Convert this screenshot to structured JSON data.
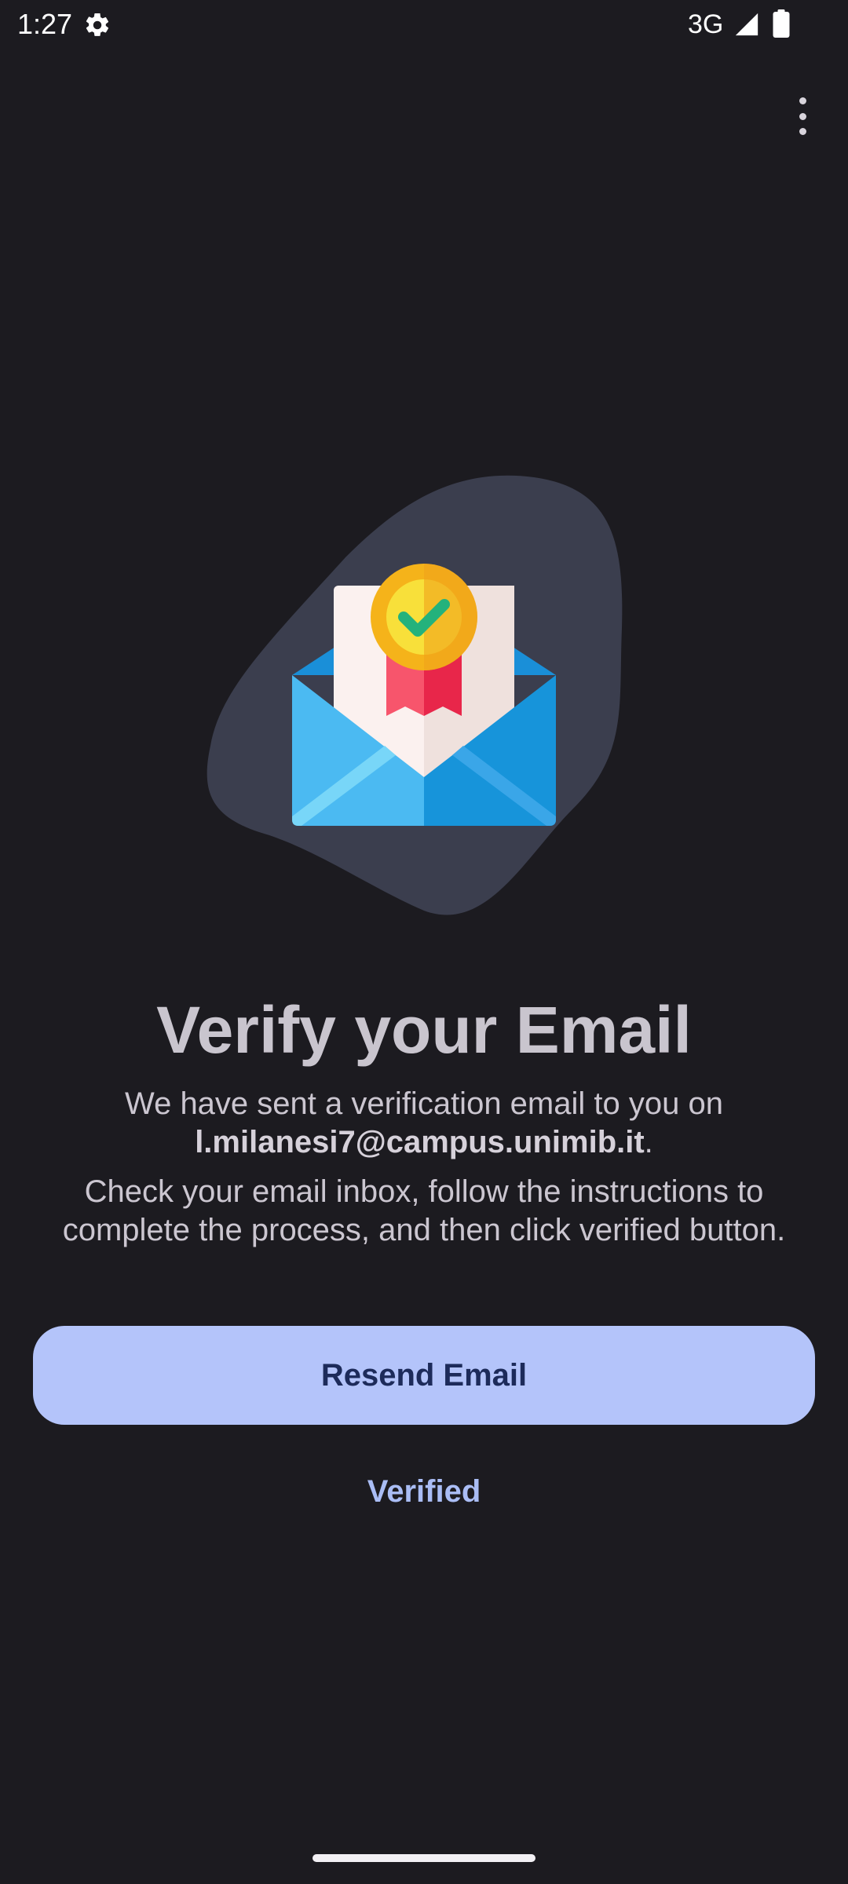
{
  "status_bar": {
    "time": "1:27",
    "network": "3G",
    "icons": [
      "gear-icon",
      "signal-icon",
      "battery-icon"
    ]
  },
  "toolbar": {
    "overflow_icon": "more-vert-icon"
  },
  "illustration": {
    "icon": "verified-email-envelope-icon"
  },
  "content": {
    "title": "Verify your Email",
    "message_prefix": "We have sent a verification email to you on",
    "email": "l.milanesi7@campus.unimib.it",
    "message_suffix": ".",
    "instructions": "Check your email inbox, follow the instructions to complete the process, and then click verified button."
  },
  "actions": {
    "resend_label": "Resend Email",
    "verified_label": "Verified"
  },
  "colors": {
    "background": "#1c1b20",
    "primary_button": "#b4c4fa",
    "primary_button_text": "#1d2b5a",
    "text_button": "#aabdf5",
    "title_text": "#c9c5ce"
  }
}
